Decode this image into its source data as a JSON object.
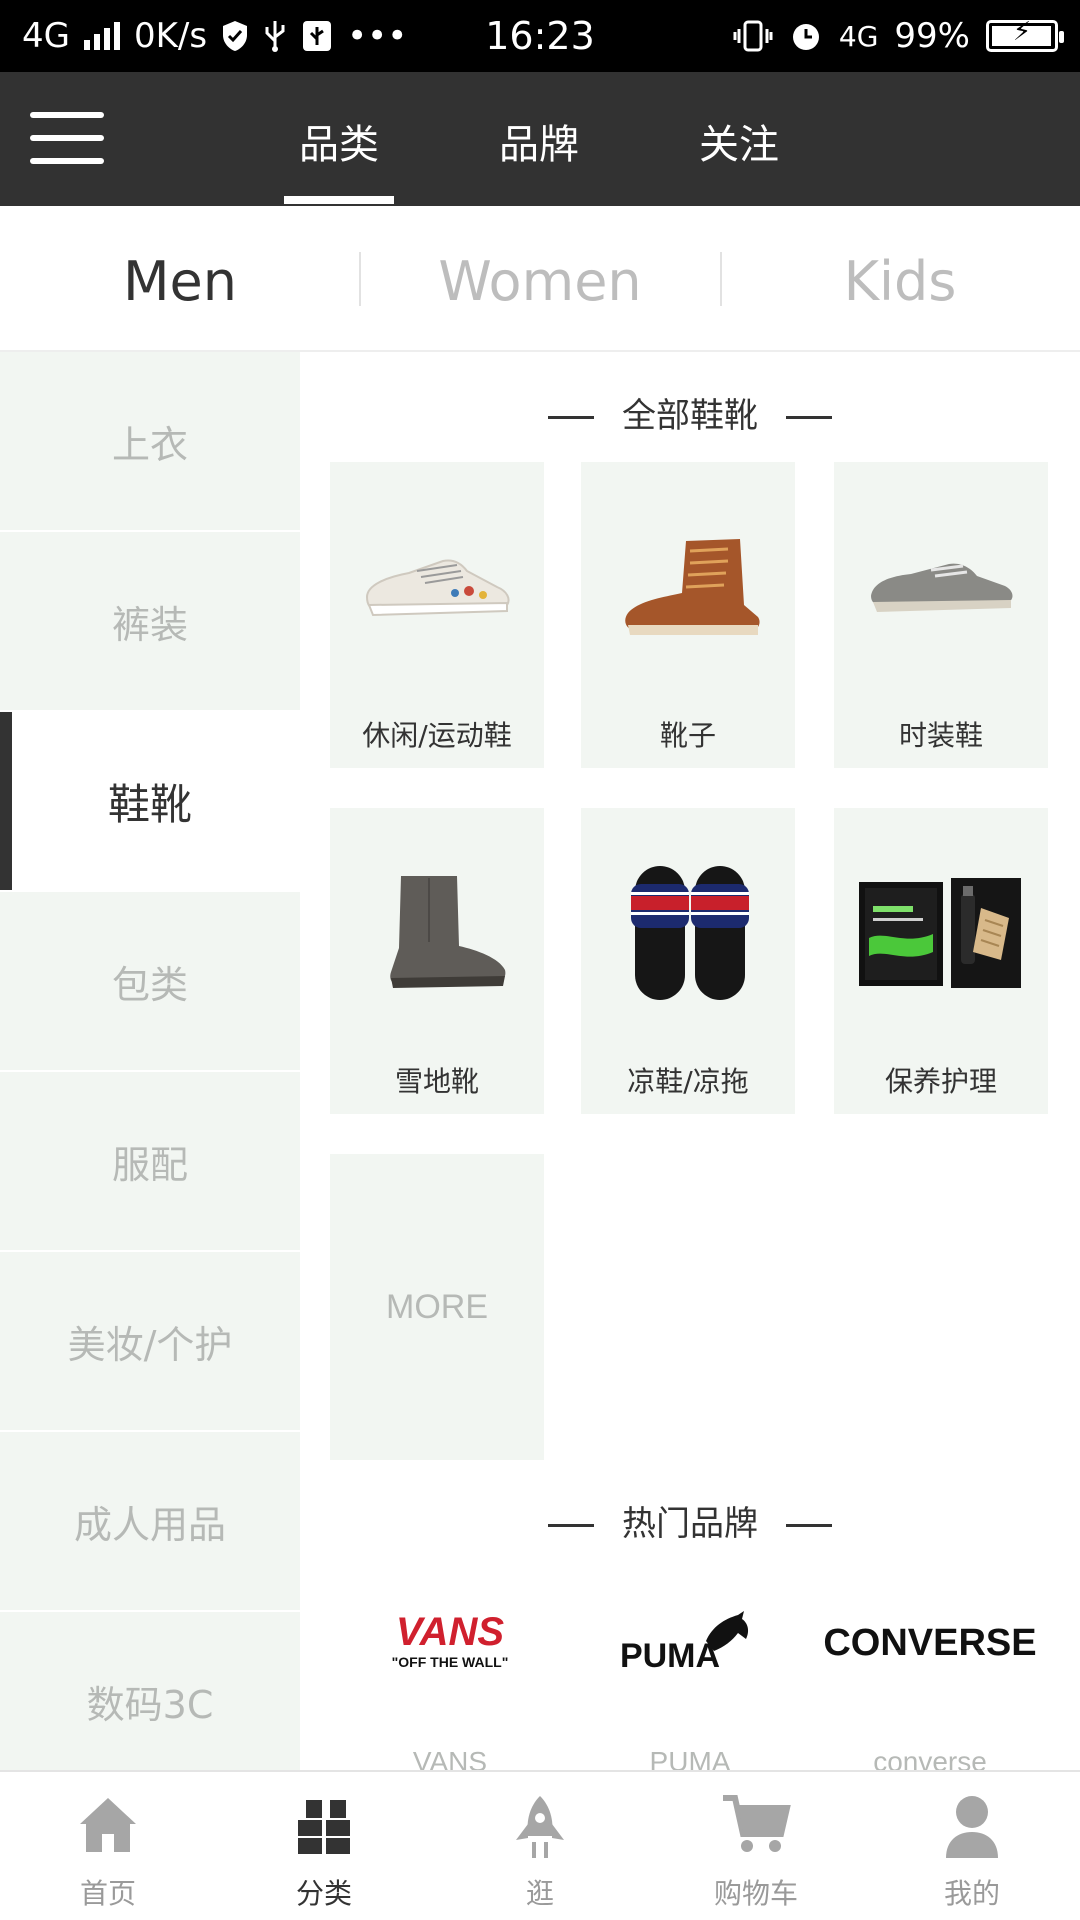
{
  "status_bar": {
    "network": "4G",
    "speed": "0K/s",
    "time": "16:23",
    "network_right": "4G",
    "battery_percent": "99%",
    "battery_level": 0.99,
    "more": "•••"
  },
  "header": {
    "tabs": [
      {
        "label": "品类",
        "active": true
      },
      {
        "label": "品牌",
        "active": false
      },
      {
        "label": "关注",
        "active": false
      }
    ]
  },
  "gender_tabs": [
    {
      "label": "Men",
      "active": true
    },
    {
      "label": "Women",
      "active": false
    },
    {
      "label": "Kids",
      "active": false
    }
  ],
  "categories": [
    {
      "label": "上衣",
      "active": false
    },
    {
      "label": "裤装",
      "active": false
    },
    {
      "label": "鞋靴",
      "active": true
    },
    {
      "label": "包类",
      "active": false
    },
    {
      "label": "服配",
      "active": false
    },
    {
      "label": "美妆/个护",
      "active": false
    },
    {
      "label": "成人用品",
      "active": false
    },
    {
      "label": "数码3C",
      "active": false
    }
  ],
  "section_all": {
    "title": "全部鞋靴",
    "items": [
      {
        "label": "休闲/运动鞋",
        "icon": "sneaker-icon"
      },
      {
        "label": "靴子",
        "icon": "boot-icon"
      },
      {
        "label": "时装鞋",
        "icon": "dress-shoe-icon"
      },
      {
        "label": "雪地靴",
        "icon": "snow-boot-icon"
      },
      {
        "label": "凉鞋/凉拖",
        "icon": "slipper-icon"
      },
      {
        "label": "保养护理",
        "icon": "shoe-care-kit-icon"
      }
    ],
    "more_label": "MORE"
  },
  "section_brands": {
    "title": "热门品牌",
    "brands": [
      {
        "logo_text": "VANS",
        "logo_sub": "\"OFF THE WALL\"",
        "name": "VANS",
        "color": "#d0202e"
      },
      {
        "logo_text": "PUMA",
        "name": "PUMA",
        "color": "#111111"
      },
      {
        "logo_text": "CONVERSE",
        "name": "converse",
        "color": "#111111"
      }
    ]
  },
  "bottom_nav": [
    {
      "label": "首页",
      "icon": "home-icon",
      "active": false
    },
    {
      "label": "分类",
      "icon": "category-icon",
      "active": true
    },
    {
      "label": "逛",
      "icon": "rocket-icon",
      "active": false
    },
    {
      "label": "购物车",
      "icon": "cart-icon",
      "active": false
    },
    {
      "label": "我的",
      "icon": "profile-icon",
      "active": false
    }
  ]
}
